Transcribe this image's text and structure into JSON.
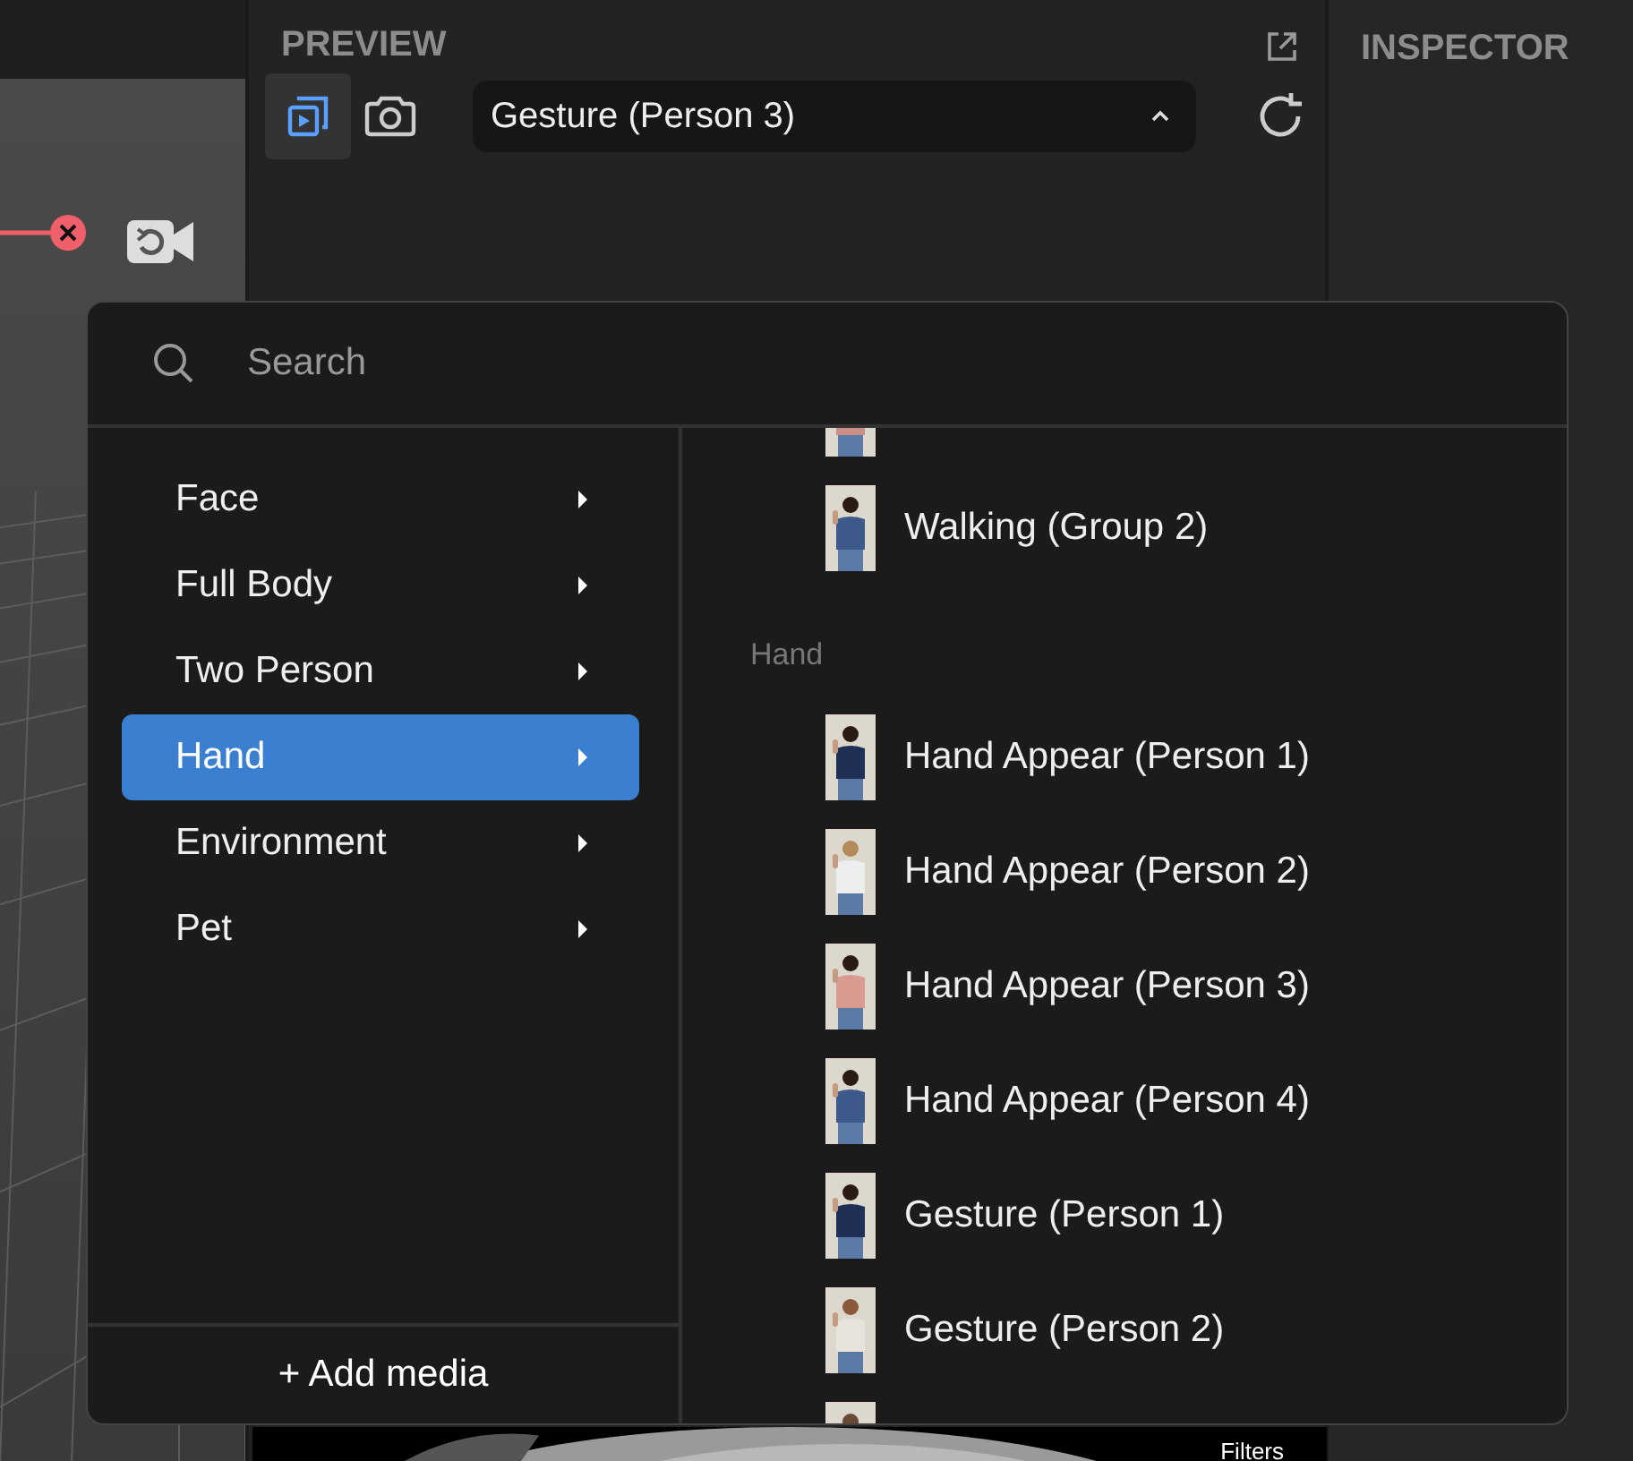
{
  "preview": {
    "title": "PREVIEW",
    "tools": [
      {
        "kind": "preview",
        "selected": true
      },
      {
        "kind": "camera",
        "selected": false
      }
    ],
    "selected_media": "Gesture (Person 3)",
    "overlay_label": "Filters"
  },
  "inspector": {
    "title": "INSPECTOR"
  },
  "media_menu": {
    "search": {
      "placeholder": "Search"
    },
    "categories": [
      {
        "label": "Face",
        "selected": false
      },
      {
        "label": "Full Body",
        "selected": false
      },
      {
        "label": "Two Person",
        "selected": false
      },
      {
        "label": "Hand",
        "selected": true
      },
      {
        "label": "Environment",
        "selected": false
      },
      {
        "label": "Pet",
        "selected": false
      }
    ],
    "add_button": "+ Add media",
    "groups": [
      {
        "items": [
          {
            "kind": "picture"
          },
          {
            "kind": "picture",
            "label": "Walking (Group 2)"
          }
        ]
      },
      {
        "header": "Hand",
        "items": [
          {
            "kind": "picture",
            "label": "Hand Appear (Person 1)"
          },
          {
            "kind": "picture",
            "label": "Hand Appear (Person 2)"
          },
          {
            "kind": "picture",
            "label": "Hand Appear (Person 3)"
          },
          {
            "kind": "picture",
            "label": "Hand Appear (Person 4)"
          },
          {
            "kind": "picture",
            "label": "Gesture (Person 1)"
          },
          {
            "kind": "picture",
            "label": "Gesture (Person 2)"
          },
          {
            "kind": "picture"
          }
        ]
      }
    ]
  }
}
